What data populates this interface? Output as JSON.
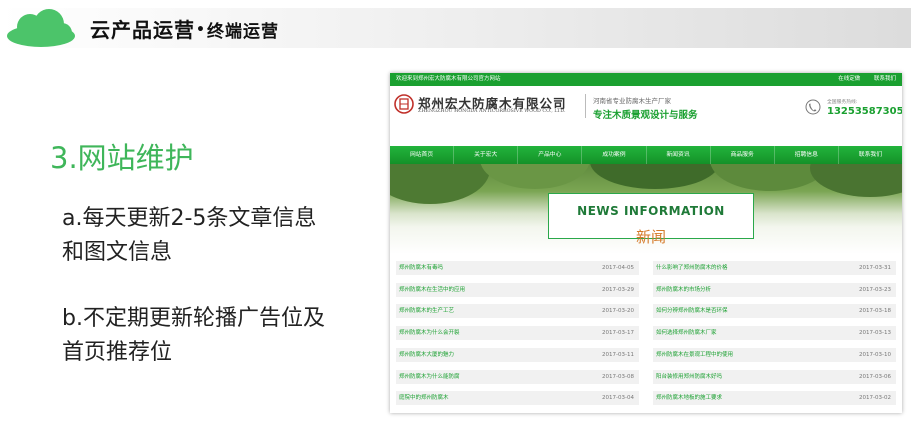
{
  "slide": {
    "title_main": "云产品运营",
    "title_dot": "•",
    "title_sub": "终端运营",
    "section_title": "3.网站维护",
    "bullet_a": "a.每天更新2-5条文章信息和图文信息",
    "bullet_b": "b.不定期更新轮播广告位及首页推荐位",
    "colors": {
      "accent": "#3fb65a",
      "site_green": "#1aa030"
    }
  },
  "site": {
    "topbar": {
      "welcome": "欢迎来到郑州宏大防腐木有限公司官方网站",
      "links": [
        "在线定做",
        "联系我们"
      ]
    },
    "company": {
      "name": "郑州宏大防腐木有限公司",
      "english": "ZHENGZHOU HONGDA ANTICORROSIVE WOOD CO., LTD.",
      "seal_icon": "company-seal-icon"
    },
    "tagline_1": "河南省专业防腐木生产厂家",
    "tagline_2": "专注木质景观设计与服务",
    "phone_label": "全国服务热线:",
    "phone_number": "13253587305",
    "nav": [
      "网站首页",
      "关于宏大",
      "产品中心",
      "成功案例",
      "新闻资讯",
      "商品服务",
      "招聘信息",
      "联系我们"
    ],
    "banner": {
      "title_en": "NEWS INFORMATION",
      "title_cn": "新闻"
    },
    "news_left": [
      {
        "title": "郑州防腐木有毒吗",
        "date": "2017-04-05"
      },
      {
        "title": "郑州防腐木在生活中的应用",
        "date": "2017-03-29"
      },
      {
        "title": "郑州防腐木的生产工艺",
        "date": "2017-03-20"
      },
      {
        "title": "郑州防腐木为什么会开裂",
        "date": "2017-03-17"
      },
      {
        "title": "郑州防腐木大厦的魅力",
        "date": "2017-03-11"
      },
      {
        "title": "郑州防腐木为什么能防腐",
        "date": "2017-03-08"
      },
      {
        "title": "庭院中的郑州防腐木",
        "date": "2017-03-04"
      }
    ],
    "news_right": [
      {
        "title": "什么影响了郑州防腐木的价格",
        "date": "2017-03-31"
      },
      {
        "title": "郑州防腐木的市场分析",
        "date": "2017-03-23"
      },
      {
        "title": "如何分辨郑州防腐木是否环保",
        "date": "2017-03-18"
      },
      {
        "title": "如何选择郑州防腐木厂家",
        "date": "2017-03-13"
      },
      {
        "title": "郑州防腐木在景观工程中的使用",
        "date": "2017-03-10"
      },
      {
        "title": "阳台装修用郑州防腐木好吗",
        "date": "2017-03-06"
      },
      {
        "title": "郑州防腐木地板的施工要求",
        "date": "2017-03-02"
      }
    ]
  }
}
